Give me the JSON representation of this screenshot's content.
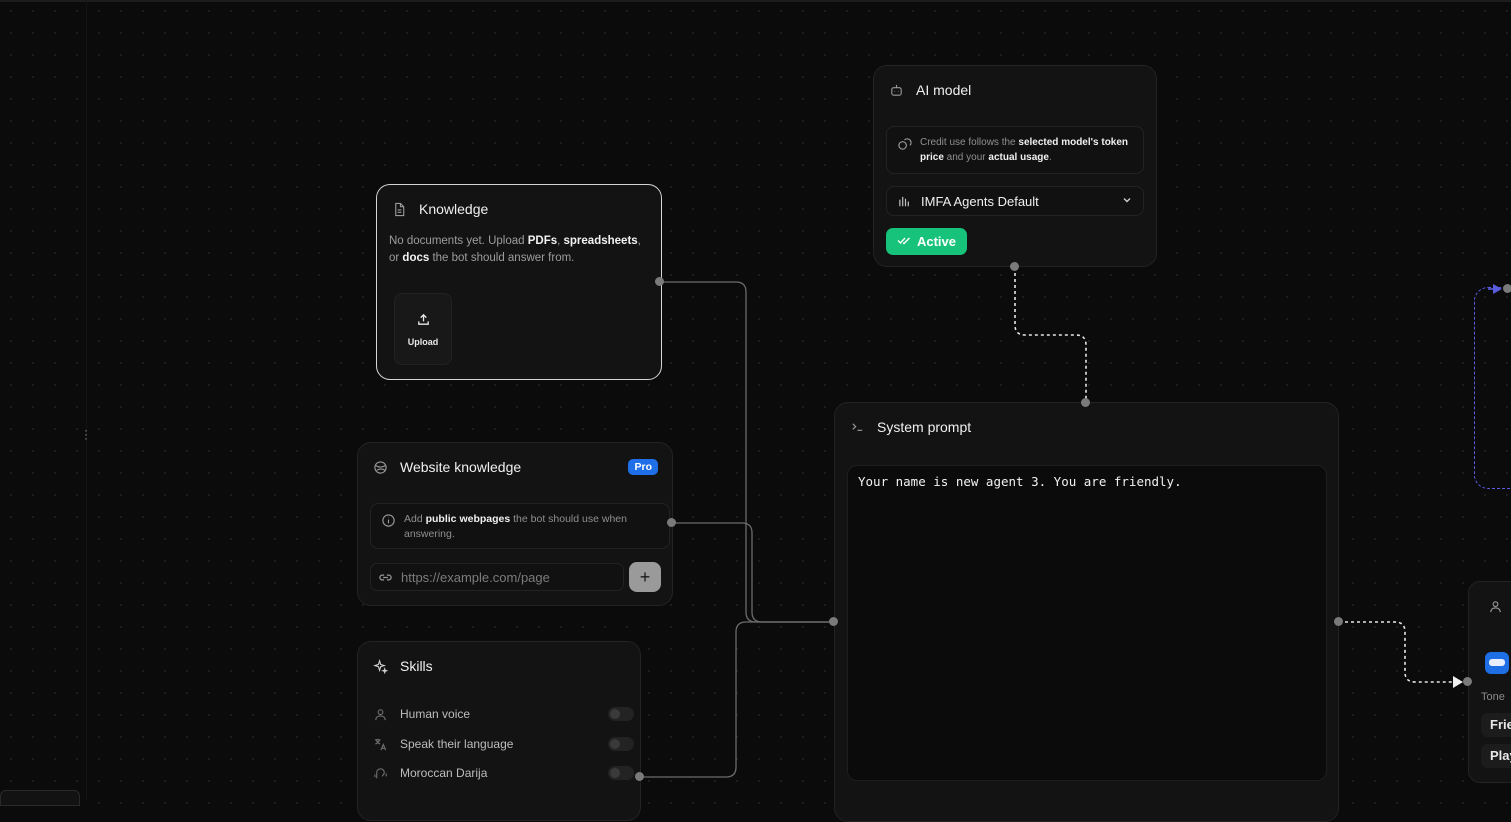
{
  "knowledge": {
    "title": "Knowledge",
    "text_pre": "No documents yet. Upload ",
    "pdfs": "PDFs",
    "sep1": ", ",
    "spreadsheets": "spreadsheets",
    "sep2": ", or ",
    "docs": "docs",
    "text_post": " the bot should answer from.",
    "upload_label": "Upload"
  },
  "website_knowledge": {
    "title": "Website knowledge",
    "badge": "Pro",
    "info_pre": "Add ",
    "info_bold": "public webpages",
    "info_post": " the bot should use when answering.",
    "url_placeholder": "https://example.com/page",
    "add_label": "+"
  },
  "skills": {
    "title": "Skills",
    "items": [
      {
        "label": "Human voice",
        "icon": "person-icon",
        "enabled": false
      },
      {
        "label": "Speak their language",
        "icon": "translate-icon",
        "enabled": false
      },
      {
        "label": "Moroccan Darija",
        "icon": "speech-icon",
        "enabled": false
      }
    ]
  },
  "ai_model": {
    "title": "AI model",
    "credit_pre": "Credit use follows the ",
    "credit_bold1": "selected model's token price",
    "credit_mid": " and your ",
    "credit_bold2": "actual usage",
    "credit_post": ".",
    "selected_model": "IMFA Agents Default",
    "status": "Active"
  },
  "system_prompt": {
    "title": "System prompt",
    "value": "Your name is new agent 3. You are friendly."
  },
  "persona": {
    "tone_label": "Tone",
    "options": [
      "Frie",
      "Play"
    ]
  },
  "colors": {
    "accent_active": "#17c27a",
    "pro_badge": "#1f6fe8",
    "dashed_border": "#5a5ce0"
  }
}
